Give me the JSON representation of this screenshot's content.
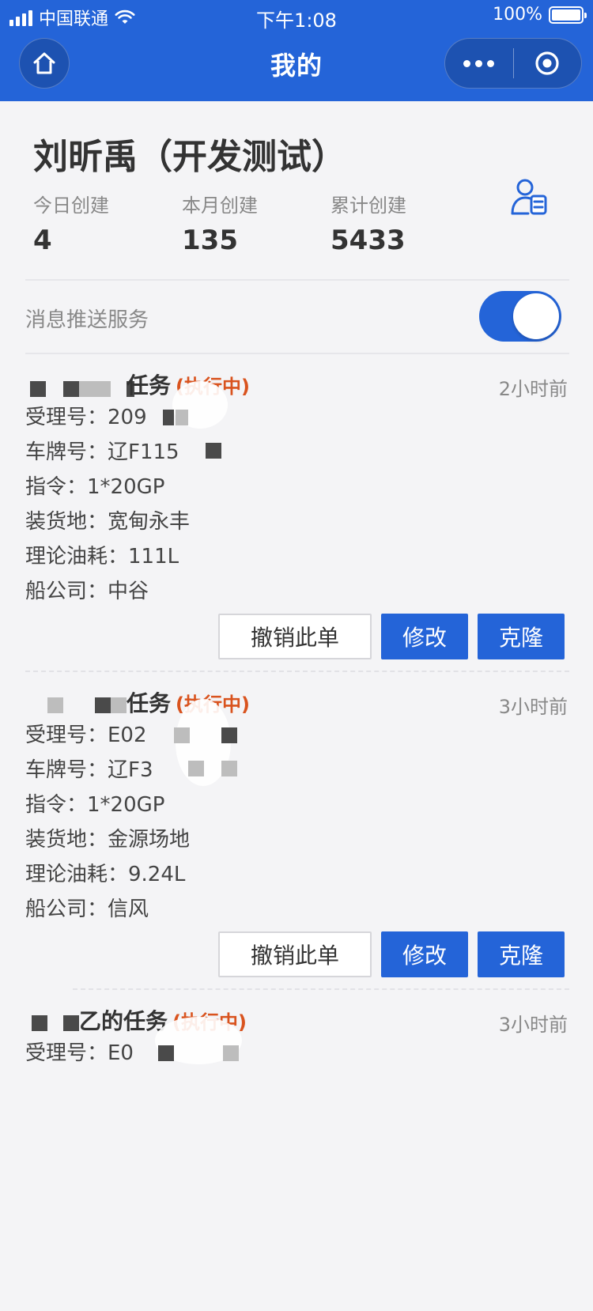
{
  "status_bar": {
    "carrier": "中国联通",
    "time": "下午1:08",
    "battery": "100%"
  },
  "nav": {
    "title": "我的"
  },
  "profile": {
    "name": "刘昕禹（开发测试）",
    "stats": [
      {
        "label": "今日创建",
        "value": "4"
      },
      {
        "label": "本月创建",
        "value": "135"
      },
      {
        "label": "累计创建",
        "value": "5433"
      }
    ]
  },
  "push": {
    "label": "消息推送服务",
    "enabled": true
  },
  "tasks": [
    {
      "title": "任务",
      "status": "(执行中)",
      "time": "2小时前",
      "rows": [
        "受理号：209",
        "车牌号：辽F115",
        "指令：1*20GP",
        "装货地：宽甸永丰",
        "理论油耗：111L",
        "船公司：中谷"
      ]
    },
    {
      "title": "任务",
      "status": "(执行中)",
      "time": "3小时前",
      "rows": [
        "受理号：E02",
        "车牌号：辽F3",
        "指令：1*20GP",
        "装货地：金源场地",
        "理论油耗：9.24L",
        "船公司：信风"
      ]
    },
    {
      "title": "乙的任务",
      "status": "(执行中)",
      "time": "3小时前",
      "rows": [
        "受理号：E0"
      ]
    }
  ],
  "actions": {
    "revoke": "撤销此单",
    "edit": "修改",
    "clone": "克隆"
  },
  "colors": {
    "primary": "#2464d8",
    "status": "#d9531e",
    "background": "#f4f4f6"
  },
  "icons": {
    "home": "home-icon",
    "more": "more-dots-icon",
    "close": "target-close-icon",
    "profile_card": "user-card-icon"
  }
}
